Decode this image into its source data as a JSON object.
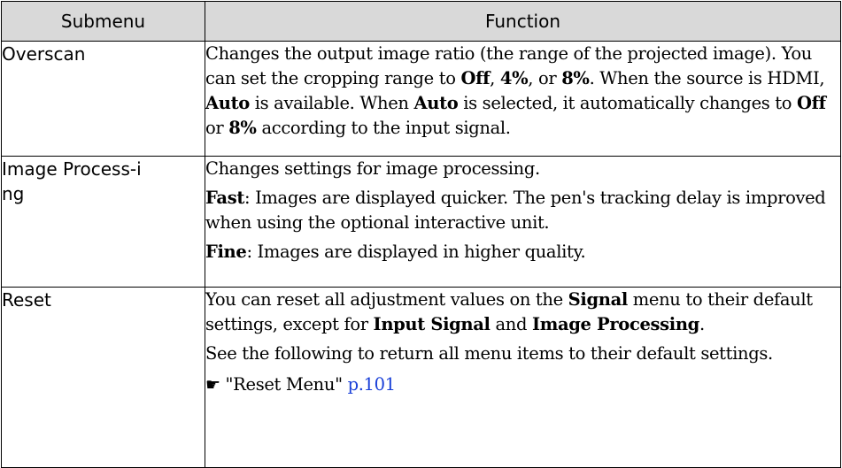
{
  "header": {
    "col1": "Submenu",
    "col2": "Function"
  },
  "rows": [
    {
      "submenu": "Overscan",
      "paragraphs": [
        [
          {
            "t": "Changes the output image ratio (the range of the projected image). You can set the cropping range to "
          },
          {
            "t": "Off",
            "b": true
          },
          {
            "t": ", "
          },
          {
            "t": "4%",
            "b": true
          },
          {
            "t": ", or "
          },
          {
            "t": "8%",
            "b": true
          },
          {
            "t": ". When the source is HDMI, "
          },
          {
            "t": "Auto",
            "b": true
          },
          {
            "t": " is available. When "
          },
          {
            "t": "Auto",
            "b": true
          },
          {
            "t": " is selected, it automatically changes to "
          },
          {
            "t": "Off",
            "b": true
          },
          {
            "t": " or "
          },
          {
            "t": "8%",
            "b": true
          },
          {
            "t": " according to the input signal."
          }
        ]
      ]
    },
    {
      "submenu": "Image Process-ing",
      "paragraphs": [
        [
          {
            "t": "Changes settings for image processing."
          }
        ],
        [
          {
            "t": "Fast",
            "b": true
          },
          {
            "t": ": Images are displayed quicker. The pen's tracking delay is improved when using the optional interactive unit."
          }
        ],
        [
          {
            "t": "Fine",
            "b": true
          },
          {
            "t": ": Images are displayed in higher quality."
          }
        ]
      ]
    },
    {
      "submenu": "Reset",
      "paragraphs": [
        [
          {
            "t": "You can reset all adjustment values on the "
          },
          {
            "t": "Signal",
            "b": true
          },
          {
            "t": " menu to their default settings, except for "
          },
          {
            "t": "Input Signal",
            "b": true
          },
          {
            "t": " and "
          },
          {
            "t": "Image Processing",
            "b": true
          },
          {
            "t": "."
          }
        ],
        [
          {
            "t": "See the following to return all menu items to their default settings."
          }
        ]
      ],
      "reference": {
        "icon": "pointing-hand-icon",
        "glyph": "☛",
        "text": "\"Reset Menu\" ",
        "page": "p.101"
      }
    }
  ],
  "colors": {
    "header_bg": "#d9d9d9",
    "border": "#000000",
    "link": "#1a40d8"
  }
}
